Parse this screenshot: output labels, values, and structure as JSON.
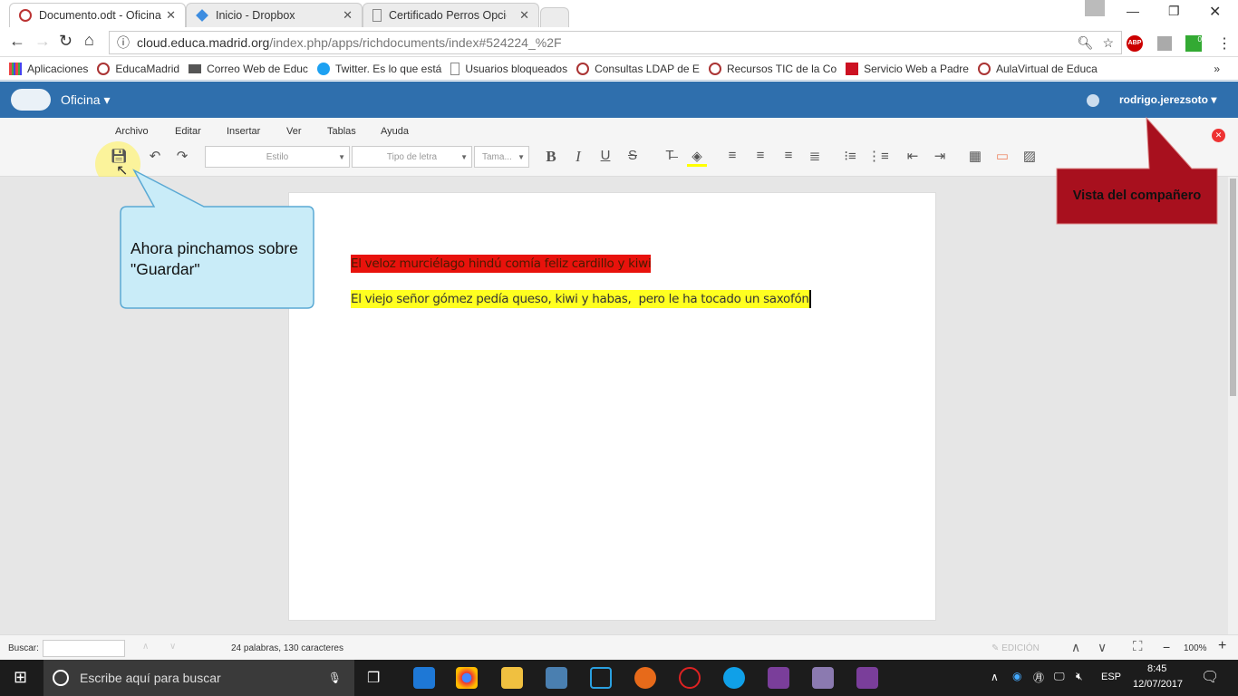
{
  "browser": {
    "tabs": [
      {
        "title": "Documento.odt - Oficina"
      },
      {
        "title": "Inicio - Dropbox"
      },
      {
        "title": "Certificado Perros Opció"
      }
    ],
    "url_host": "cloud.educa.madrid.org",
    "url_path": "/index.php/apps/richdocuments/index#524224_%2F",
    "bookmarks": [
      "Aplicaciones",
      "EducaMadrid",
      "Correo Web de Educ",
      "Twitter. Es lo que está",
      "Usuarios bloqueados",
      "Consultas LDAP de E",
      "Recursos TIC de la Co",
      "Servicio Web a Padre",
      "AulaVirtual de Educa"
    ],
    "extension_badge": "0",
    "abp": "ABP"
  },
  "app": {
    "name": "Oficina",
    "user": "rodrigo.jerezsoto"
  },
  "menu": [
    "Archivo",
    "Editar",
    "Insertar",
    "Ver",
    "Tablas",
    "Ayuda"
  ],
  "toolbar": {
    "style_placeholder": "Estilo",
    "font_placeholder": "Tipo de letra",
    "size_placeholder": "Tama..."
  },
  "document": {
    "lines": [
      {
        "text": "El veloz murciélago hindú comía feliz cardillo y kiwi",
        "highlight": "#e8120c"
      },
      {
        "text": "El viejo señor gómez pedía queso, kiwi y habas,  pero le ha tocado un saxofón",
        "highlight": "#ffff20"
      }
    ]
  },
  "callouts": {
    "tip": "Ahora pinchamos sobre \"Guardar\"",
    "partner": "Vista del compañero"
  },
  "status": {
    "search_label": "Buscar:",
    "count": "24 palabras, 130 caracteres",
    "mode": "EDICIÓN",
    "zoom": "100%"
  },
  "taskbar": {
    "search_placeholder": "Escribe aquí para buscar",
    "lang": "ESP",
    "time": "8:45",
    "date": "12/07/2017"
  }
}
